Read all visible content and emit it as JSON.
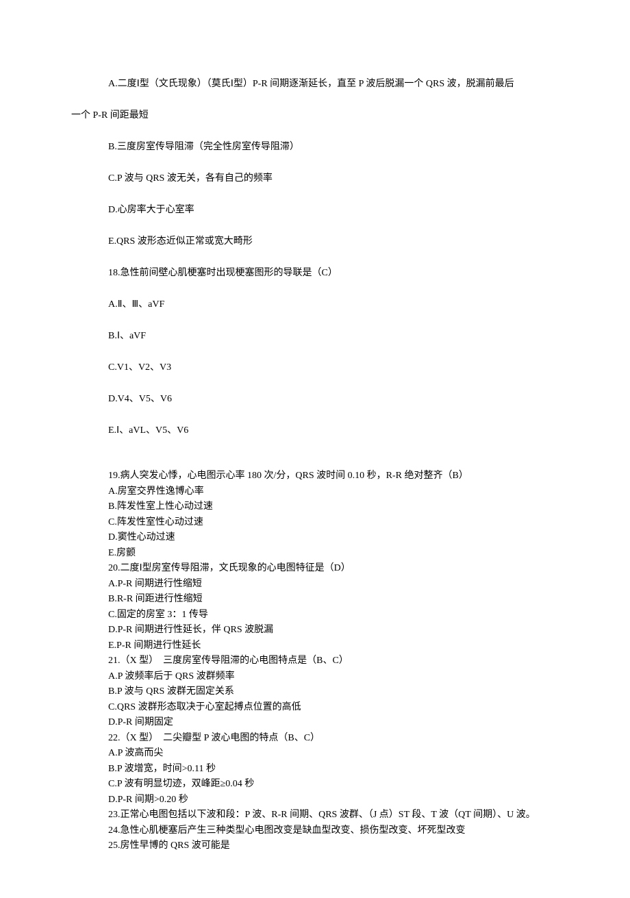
{
  "spaced": [
    "A.二度Ⅰ型（文氏现象）（莫氏Ⅰ型）P-R 间期逐渐延长，直至 P 波后脱漏一个 QRS 波，脱漏前最后",
    "一个 P-R 间距最短",
    "B.三度房室传导阻滞（完全性房室传导阻滞）",
    "C.P 波与 QRS 波无关，各有自己的频率",
    "D.心房率大于心室率",
    "E.QRS 波形态近似正常或宽大畸形",
    "18.急性前间壁心肌梗塞时出现梗塞图形的导联是（C）",
    "A.Ⅱ、Ⅲ、aVF",
    "B.Ⅰ、aVF",
    "C.V1、V2、V3",
    "D.V4、V5、V6",
    "E.Ⅰ、aVL、V5、V6"
  ],
  "tight": [
    "19.病人突发心悸，心电图示心率 180 次/分，QRS 波时间 0.10 秒，R-R 绝对整齐（B）",
    "A.房室交界性逸博心率",
    "B.阵发性室上性心动过速",
    "C.阵发性室性心动过速",
    "D.窦性心动过速",
    "E.房颤",
    "20.二度Ⅰ型房室传导阻滞，文氏现象的心电图特征是（D）",
    "A.P-R 间期进行性缩短",
    "B.R-R 间距进行性缩短",
    "C.固定的房室 3：1 传导",
    "D.P-R 间期进行性延长，伴 QRS 波脱漏",
    "E.P-R 间期进行性延长",
    "21.（X 型）  三度房室传导阻滞的心电图特点是（B、C）",
    "A.P 波频率后于 QRS 波群频率",
    "B.P 波与 QRS 波群无固定关系",
    "C.QRS 波群形态取决于心室起搏点位置的高低",
    "D.P-R 间期固定",
    "22.（X 型）  二尖瓣型 P 波心电图的特点（B、C）",
    "A.P 波高而尖",
    "B.P 波增宽，时间>0.11 秒",
    "C.P 波有明显切迹，双峰距≥0.04 秒",
    "D.P-R 间期>0.20 秒",
    "23.正常心电图包括以下波和段：P 波、R-R 间期、QRS 波群、（J 点）ST 段、T 波（QT 间期）、U 波。",
    "24.急性心肌梗塞后产生三种类型心电图改变是缺血型改变、损伤型改变、坏死型改变",
    "25.房性早博的 QRS 波可能是"
  ]
}
